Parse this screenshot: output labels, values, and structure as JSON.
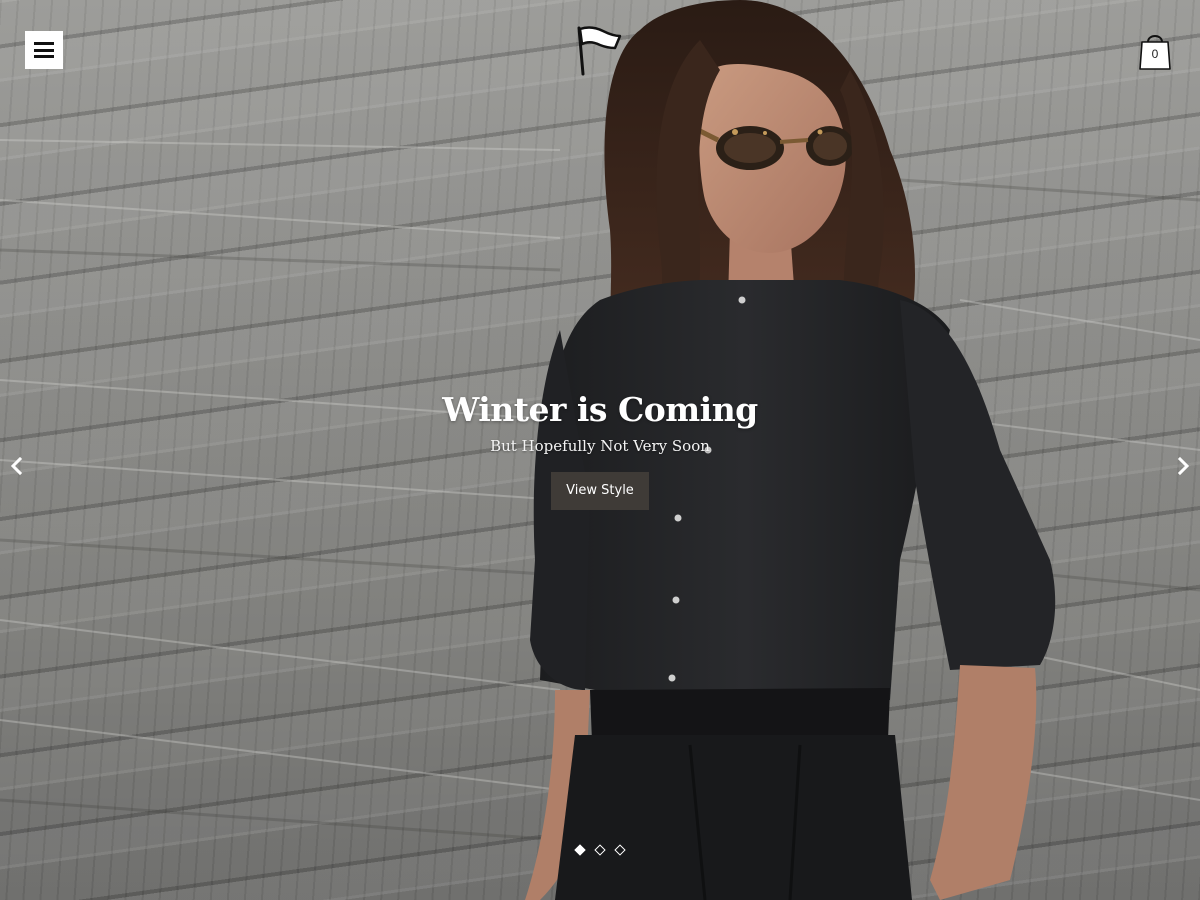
{
  "header": {
    "menu_icon": "hamburger-menu-icon",
    "logo_icon": "flag-logo-icon",
    "cart_icon": "shopping-bag-icon",
    "cart_count": "0"
  },
  "slider": {
    "prev_icon": "chevron-left-icon",
    "next_icon": "chevron-right-icon",
    "active_slide": 1,
    "slide_count": 3,
    "slide": {
      "title": "Winter is Coming",
      "subtitle": "But Hopefully Not Very Soon",
      "button_label": "View Style"
    }
  },
  "colors": {
    "button_bg": "#3f3b37",
    "text": "#ffffff",
    "menu_bg": "#ffffff"
  }
}
